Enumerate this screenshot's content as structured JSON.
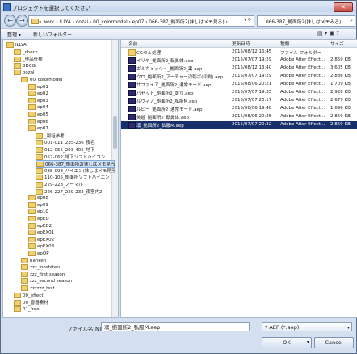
{
  "window": {
    "title": "プロジェクトを選択してください",
    "close_glyph": "✕"
  },
  "nav": {
    "back_glyph": "←",
    "forward_glyph": "→",
    "address": "« work › ILLYA › oozai › 00_colormodel › ep07 › 066-387_拠面所2(抹しはメモ見ろ) ›",
    "address_arrows": "▾ ⟳",
    "search": "066-387_拠面所2(抹しはメモみろ)",
    "search_glyph": "⌕"
  },
  "toolbar": {
    "organize": "整理 ▾",
    "new_folder": "新しいフォルダー",
    "right_icons": "▤ ▾  ▣  ?"
  },
  "tree": [
    {
      "label": "ILLYA",
      "indent": 0
    },
    {
      "label": "_check",
      "indent": 1
    },
    {
      "label": "_作品仕様",
      "indent": 1
    },
    {
      "label": "3DCG",
      "indent": 1
    },
    {
      "label": "oozai",
      "indent": 1
    },
    {
      "label": "00_colormodel",
      "indent": 2
    },
    {
      "label": "ep01",
      "indent": 3
    },
    {
      "label": "ep02",
      "indent": 3
    },
    {
      "label": "ep03",
      "indent": 3
    },
    {
      "label": "ep04",
      "indent": 3
    },
    {
      "label": "ep05",
      "indent": 3
    },
    {
      "label": "ep06",
      "indent": 3
    },
    {
      "label": "ep07",
      "indent": 3
    },
    {
      "label": "_副話参考",
      "indent": 4
    },
    {
      "label": "001-011_235-236_夜色",
      "indent": 4
    },
    {
      "label": "012-055_293-405_地下",
      "indent": 4
    },
    {
      "label": "057-062_地下ソフトハイコン",
      "indent": 4
    },
    {
      "label": "066-387_拠面所2(抹しはメモ見ろ",
      "indent": 4,
      "selected": true
    },
    {
      "label": "088-098_ハイエン(抹しはメモ見ろ",
      "indent": 4
    },
    {
      "label": "110-105_拠面所ソフトハイエン",
      "indent": 4
    },
    {
      "label": "229-228_ノーマル",
      "indent": 4
    },
    {
      "label": "226-227_229-232_夜室内2",
      "indent": 4
    },
    {
      "label": "ep08",
      "indent": 3
    },
    {
      "label": "ep09",
      "indent": 3
    },
    {
      "label": "ep10",
      "indent": 3
    },
    {
      "label": "epED",
      "indent": 3
    },
    {
      "label": "epED2",
      "indent": 3
    },
    {
      "label": "epEX01",
      "indent": 3
    },
    {
      "label": "epEX02",
      "indent": 3
    },
    {
      "label": "epEX03",
      "indent": 3
    },
    {
      "label": "epOP",
      "indent": 3
    },
    {
      "label": "hanken",
      "indent": 2
    },
    {
      "label": "zzz_inoshiteru",
      "indent": 2
    },
    {
      "label": "zzz_first season",
      "indent": 2
    },
    {
      "label": "zzz_second season",
      "indent": 2
    },
    {
      "label": "zzzzzz_test",
      "indent": 2
    },
    {
      "label": "00_effect",
      "indent": 1
    },
    {
      "label": "00_音器素材",
      "indent": 1
    },
    {
      "label": "01_free",
      "indent": 1
    }
  ],
  "list": {
    "headers": {
      "name": "名前",
      "date": "更新日時",
      "type": "種類",
      "size": "サイズ"
    },
    "rows": [
      {
        "name": "CGセル処理",
        "date": "2015/08/12 16:45",
        "type": "ファイル フォルダー",
        "size": "",
        "icon": "folder"
      },
      {
        "name": "イリヤ_拠面所2_転鼻体.aep",
        "date": "2015/07/07 19:29",
        "type": "Adobe After Effect...",
        "size": "2,859 KB",
        "icon": "ae"
      },
      {
        "name": "ギルガメッシュ_拠面所2_黒.aep",
        "date": "2015/08/12 13:40",
        "type": "Adobe After Effect...",
        "size": "3,605 KB",
        "icon": "ae"
      },
      {
        "name": "クロ_拠面所2_アーチャー刃刺ボ(印刷).aep",
        "date": "2015/07/07 19:29",
        "type": "Adobe After Effect...",
        "size": "2,886 KB",
        "icon": "ae"
      },
      {
        "name": "サファイア_拠面所2_通常モード.aep",
        "date": "2015/08/06 20:21",
        "type": "Adobe After Effect...",
        "size": "1,709 KB",
        "icon": "ae"
      },
      {
        "name": "バゼット_拠面所2_黄立.aep",
        "date": "2015/07/07 19:35",
        "type": "Adobe After Effect...",
        "size": "2,928 KB",
        "icon": "ae"
      },
      {
        "name": "ルヴィア_拠面所2_私服M.aep",
        "date": "2015/07/07 20:17",
        "type": "Adobe After Effect...",
        "size": "2,679 KB",
        "icon": "ae"
      },
      {
        "name": "ルビー_拠面所2_通常モード.aep",
        "date": "2015/08/06 19:48",
        "type": "Adobe After Effect...",
        "size": "1,696 KB",
        "icon": "ae"
      },
      {
        "name": "美遊_拠面所2_転鼻体.aep",
        "date": "2015/08/06 20:25",
        "type": "Adobe After Effect...",
        "size": "2,859 KB",
        "icon": "ae"
      },
      {
        "name": "凛_拠面所2_私服M.aep",
        "date": "2015/07/07 20:32",
        "type": "Adobe After Effect...",
        "size": "2,859 KB",
        "icon": "ae",
        "selected": true
      }
    ]
  },
  "footer": {
    "filename_label": "ファイル名(N):",
    "filename_value": "凛_拠面所2_私服M.aep",
    "filetype_value": "* AEP (*.aep)",
    "dropdown_glyph": "▾",
    "ok_label": "OK",
    "cancel_label": "Cancel"
  }
}
